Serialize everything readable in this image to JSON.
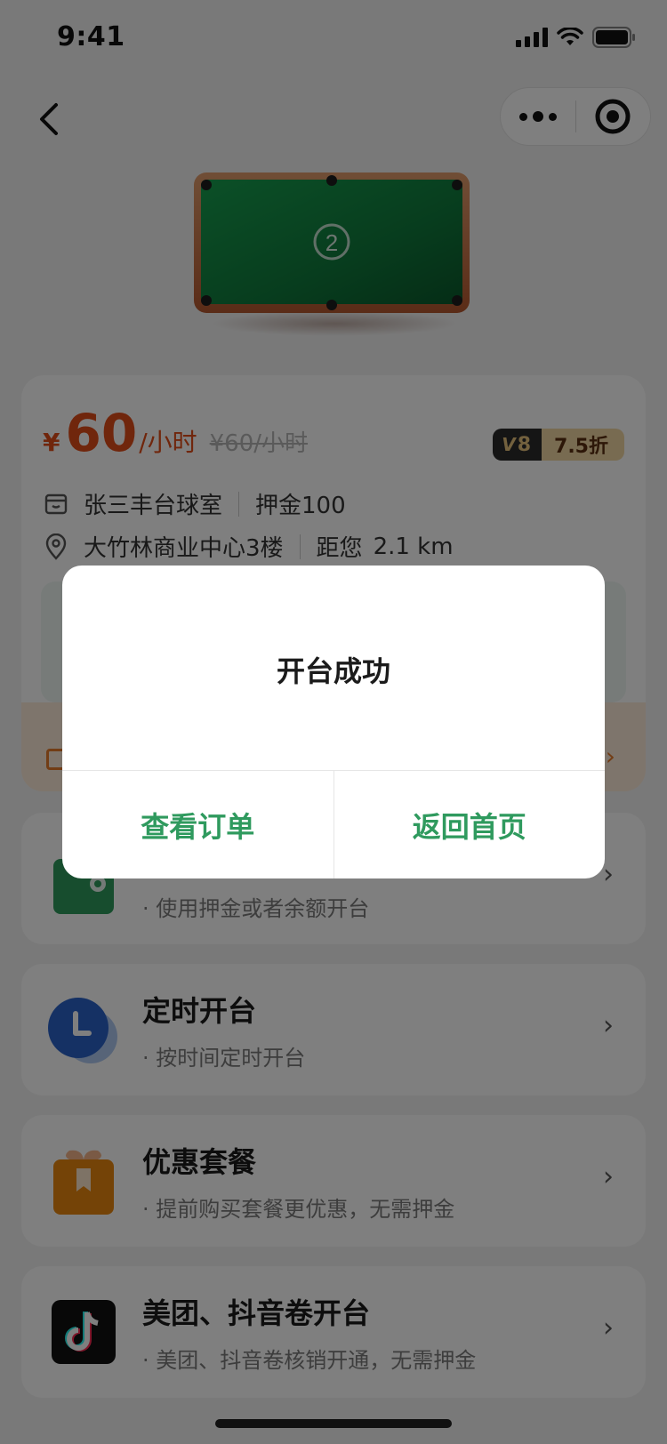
{
  "status_bar": {
    "time": "9:41"
  },
  "table": {
    "number": "2"
  },
  "info": {
    "price_currency": "¥",
    "price_value": "60",
    "price_unit": "/小时",
    "price_original": "¥60/小时",
    "vip_level": "8",
    "discount": "7.5折",
    "store_name": "张三丰台球室",
    "deposit": "押金100",
    "address": "大竹林商业中心3楼",
    "distance_label": "距您",
    "distance": "2.1 km"
  },
  "options": [
    {
      "title": "",
      "subtitle": "· 使用押金或者余额开台"
    },
    {
      "title": "定时开台",
      "subtitle": "· 按时间定时开台"
    },
    {
      "title": "优惠套餐",
      "subtitle": "· 提前购买套餐更优惠，无需押金"
    },
    {
      "title": "美团、抖音卷开台",
      "subtitle": "· 美团、抖音卷核销开通，无需押金"
    }
  ],
  "chevron": "›",
  "modal": {
    "title": "开台成功",
    "left_button": "查看订单",
    "right_button": "返回首页"
  },
  "colors": {
    "price": "#e04c19",
    "accent_green": "#2f9a5e",
    "table_felt": "#0f7a3c",
    "clock_blue": "#2a62c9",
    "gift_orange": "#e8870f"
  }
}
